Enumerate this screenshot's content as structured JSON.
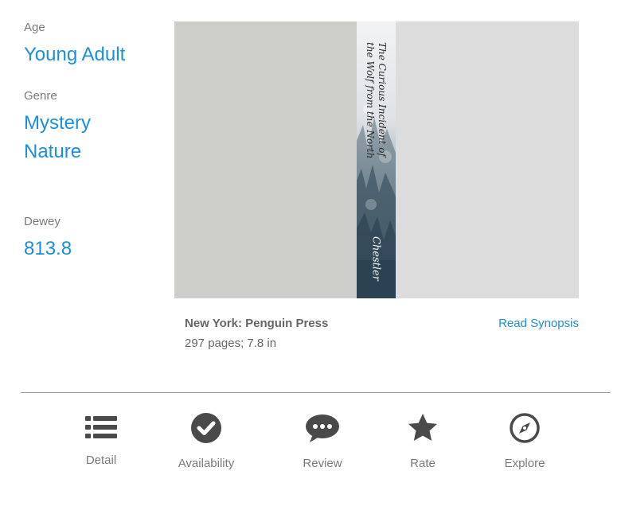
{
  "sidebar": {
    "age_label": "Age",
    "age_value": "Young Adult",
    "genre_label": "Genre",
    "genre_values": [
      "Mystery",
      "Nature"
    ],
    "dewey_label": "Dewey",
    "dewey_value": "813.8"
  },
  "book": {
    "spine_title_line1": "The Curious Incident of",
    "spine_title_line2": "the Wolf from the North",
    "spine_author": "Chestler",
    "publisher": "New York: Penguin Press",
    "physical": "297 pages; 7.8 in",
    "read_synopsis": "Read Synopsis"
  },
  "nav": {
    "items": [
      {
        "label": "Detail",
        "icon": "list-icon"
      },
      {
        "label": "Availability",
        "icon": "check-circle-icon"
      },
      {
        "label": "Review",
        "icon": "speech-bubble-icon"
      },
      {
        "label": "Rate",
        "icon": "star-icon"
      },
      {
        "label": "Explore",
        "icon": "compass-icon"
      }
    ]
  },
  "colors": {
    "accent": "#1a8fdc",
    "muted_text": "#7a7a7a",
    "icon": "#4a4a4a"
  }
}
